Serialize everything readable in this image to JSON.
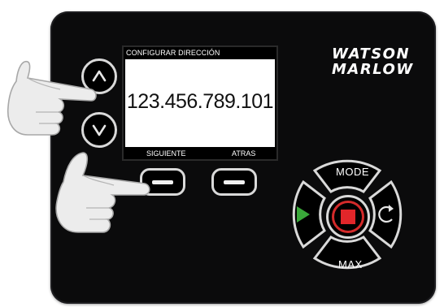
{
  "brand": {
    "line1": "WATSON",
    "line2": "MARLOW"
  },
  "lcd": {
    "title": "CONFIGURAR DIRECCIÓN",
    "value": "123.456.789.101",
    "left_softkey_label": "SIGUIENTE",
    "right_softkey_label": "ATRAS"
  },
  "keypad": {
    "mode_label": "MODE",
    "max_label": "MAX"
  },
  "icons": {
    "up": "chevron-up-icon",
    "down": "chevron-down-icon",
    "start": "play-icon",
    "stop": "stop-icon",
    "direction": "refresh-icon"
  },
  "colors": {
    "panel": "#0b0b0c",
    "start_green": "#3aa83a",
    "stop_red": "#e2262a",
    "button_outline": "#d9d9d9"
  }
}
